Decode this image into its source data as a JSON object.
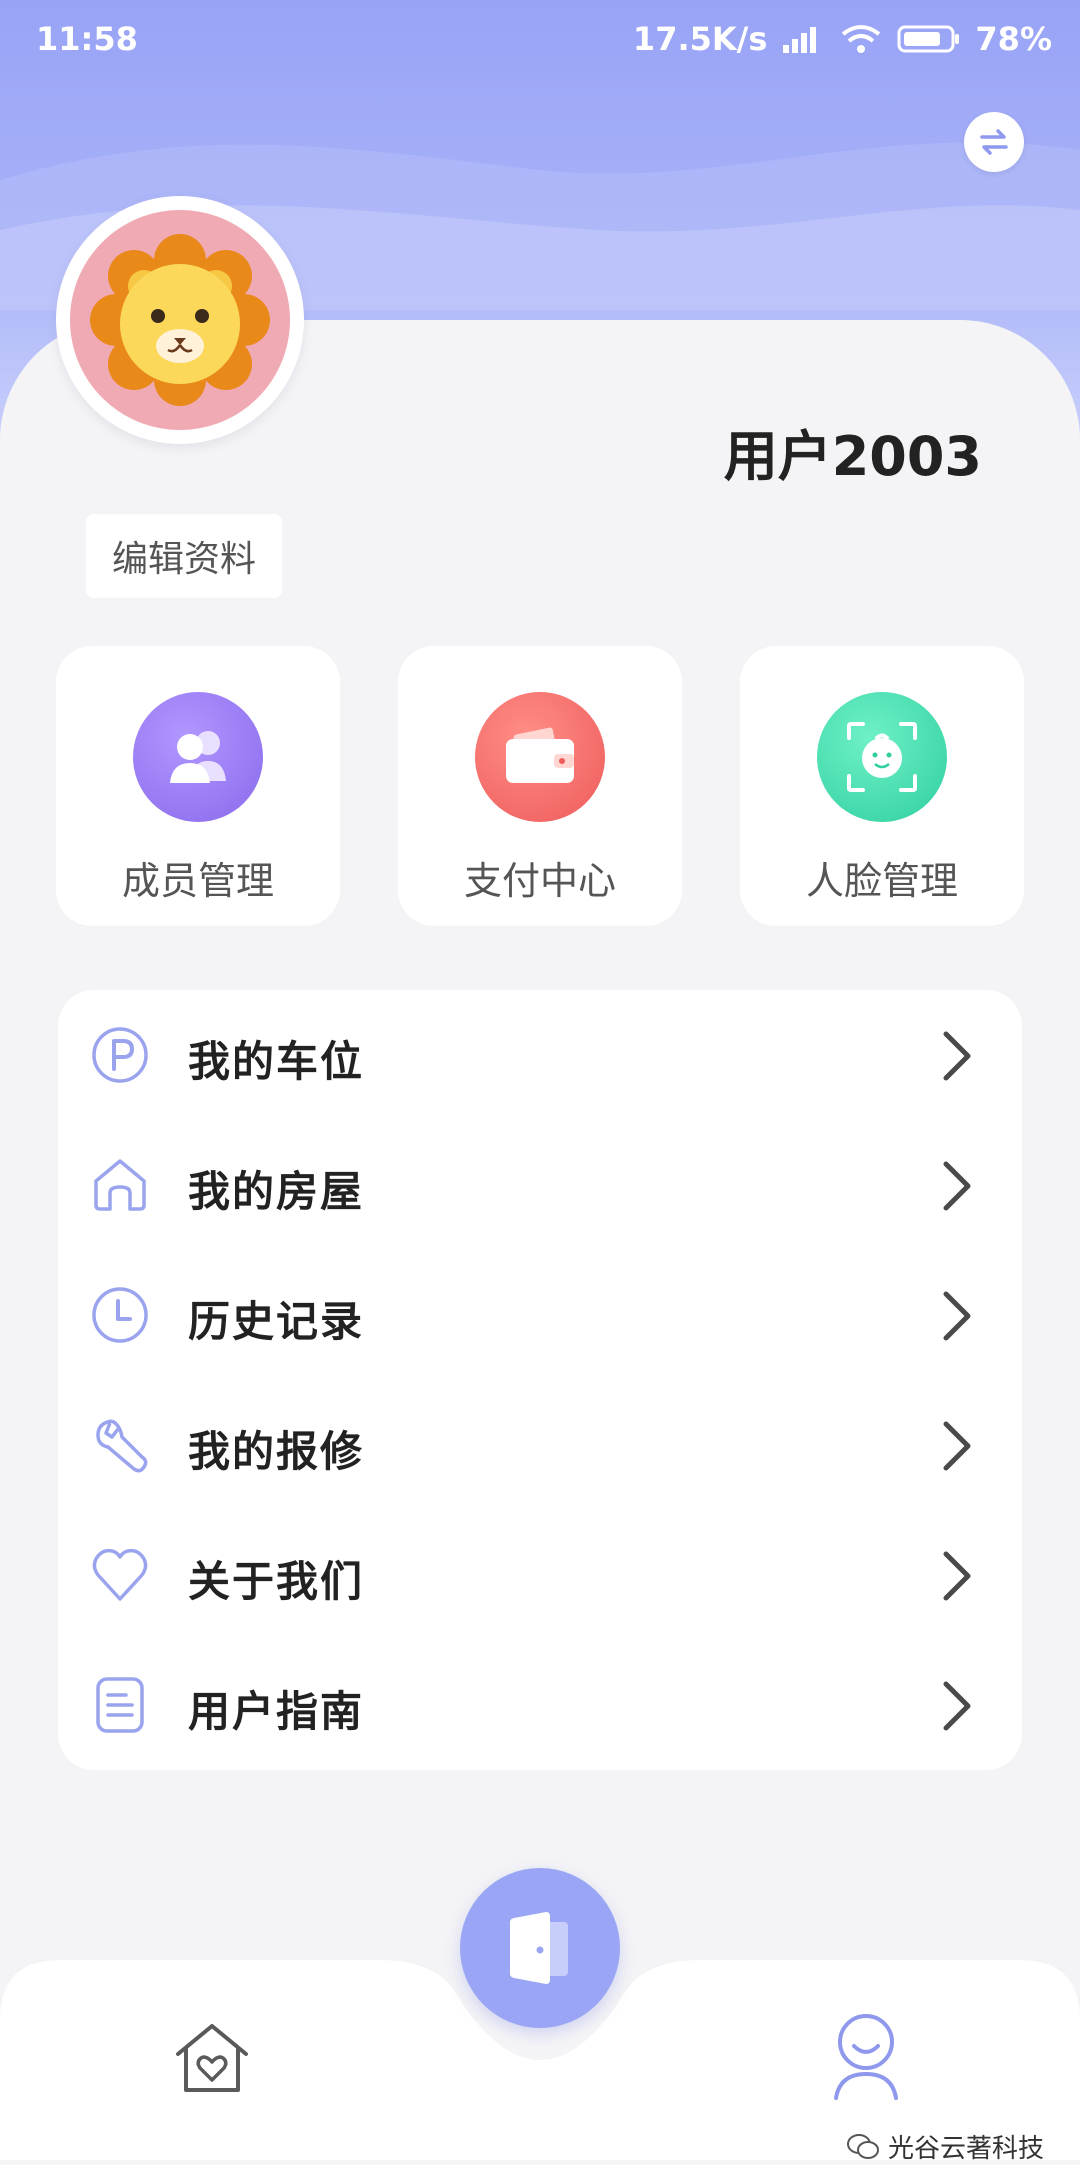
{
  "status_bar": {
    "time": "11:58",
    "net_speed": "17.5K/s",
    "battery": "78%"
  },
  "profile": {
    "username": "用户2003",
    "edit_label": "编辑资料"
  },
  "tiles": [
    {
      "label": "成员管理",
      "icon": "members-icon",
      "color": "#9b7cf0"
    },
    {
      "label": "支付中心",
      "icon": "wallet-icon",
      "color": "#f26a6a"
    },
    {
      "label": "人脸管理",
      "icon": "face-scan-icon",
      "color": "#3fd6ad"
    }
  ],
  "menu": [
    {
      "label": "我的车位",
      "icon": "parking-icon"
    },
    {
      "label": "我的房屋",
      "icon": "house-icon"
    },
    {
      "label": "历史记录",
      "icon": "clock-icon"
    },
    {
      "label": "我的报修",
      "icon": "wrench-icon"
    },
    {
      "label": "关于我们",
      "icon": "heart-icon"
    },
    {
      "label": "用户指南",
      "icon": "document-icon"
    }
  ],
  "watermark": "光谷云著科技",
  "colors": {
    "accent": "#98a3f6",
    "icon_line": "#9aa4ee"
  }
}
